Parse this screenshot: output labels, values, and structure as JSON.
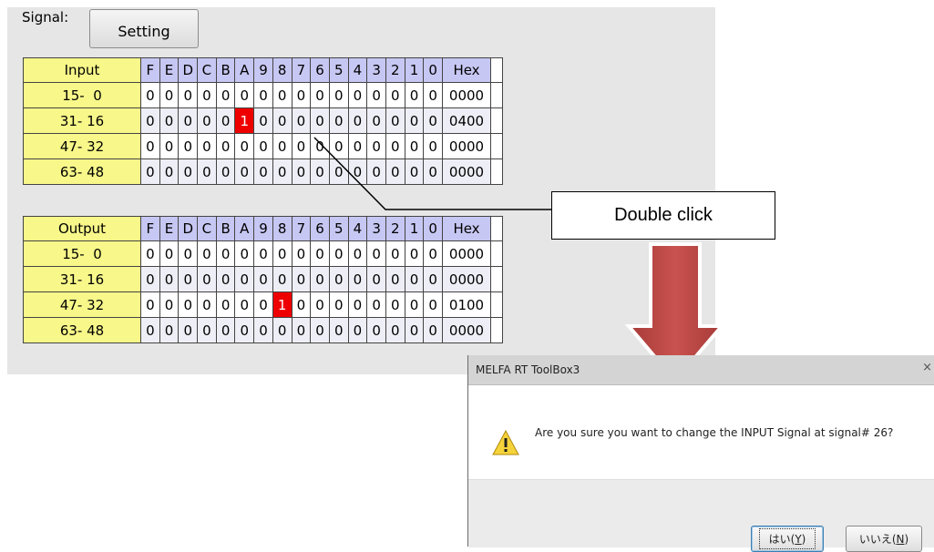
{
  "signal": {
    "label": "Signal:",
    "setting_button": "Setting"
  },
  "bit_headers": [
    "F",
    "E",
    "D",
    "C",
    "B",
    "A",
    "9",
    "8",
    "7",
    "6",
    "5",
    "4",
    "3",
    "2",
    "1",
    "0"
  ],
  "input": {
    "title": "Input",
    "hex_header": "Hex",
    "rows": [
      {
        "range": "15-  0",
        "bits": [
          "0",
          "0",
          "0",
          "0",
          "0",
          "0",
          "0",
          "0",
          "0",
          "0",
          "0",
          "0",
          "0",
          "0",
          "0",
          "0"
        ],
        "hex": "0000"
      },
      {
        "range": "31- 16",
        "bits": [
          "0",
          "0",
          "0",
          "0",
          "0",
          "1",
          "0",
          "0",
          "0",
          "0",
          "0",
          "0",
          "0",
          "0",
          "0",
          "0"
        ],
        "hex": "0400"
      },
      {
        "range": "47- 32",
        "bits": [
          "0",
          "0",
          "0",
          "0",
          "0",
          "0",
          "0",
          "0",
          "0",
          "0",
          "0",
          "0",
          "0",
          "0",
          "0",
          "0"
        ],
        "hex": "0000"
      },
      {
        "range": "63- 48",
        "bits": [
          "0",
          "0",
          "0",
          "0",
          "0",
          "0",
          "0",
          "0",
          "0",
          "0",
          "0",
          "0",
          "0",
          "0",
          "0",
          "0"
        ],
        "hex": "0000"
      }
    ]
  },
  "output": {
    "title": "Output",
    "hex_header": "Hex",
    "rows": [
      {
        "range": "15-  0",
        "bits": [
          "0",
          "0",
          "0",
          "0",
          "0",
          "0",
          "0",
          "0",
          "0",
          "0",
          "0",
          "0",
          "0",
          "0",
          "0",
          "0"
        ],
        "hex": "0000"
      },
      {
        "range": "31- 16",
        "bits": [
          "0",
          "0",
          "0",
          "0",
          "0",
          "0",
          "0",
          "0",
          "0",
          "0",
          "0",
          "0",
          "0",
          "0",
          "0",
          "0"
        ],
        "hex": "0000"
      },
      {
        "range": "47- 32",
        "bits": [
          "0",
          "0",
          "0",
          "0",
          "0",
          "0",
          "0",
          "1",
          "0",
          "0",
          "0",
          "0",
          "0",
          "0",
          "0",
          "0"
        ],
        "hex": "0100"
      },
      {
        "range": "63- 48",
        "bits": [
          "0",
          "0",
          "0",
          "0",
          "0",
          "0",
          "0",
          "0",
          "0",
          "0",
          "0",
          "0",
          "0",
          "0",
          "0",
          "0"
        ],
        "hex": "0000"
      }
    ]
  },
  "callout": {
    "text": "Double click"
  },
  "dialog": {
    "title": "MELFA RT ToolBox3",
    "close_glyph": "×",
    "message": "Are you sure you want to change the INPUT Signal at signal# 26?",
    "yes_text": "はい(",
    "yes_key": "Y",
    "yes_end": ")",
    "no_text": "いいえ(",
    "no_key": "N",
    "no_end": ")"
  },
  "colors": {
    "on": "#ee0000",
    "row_label": "#f7f78a",
    "bit_header": "#c7c7f3",
    "arrow": "#c0504d"
  }
}
